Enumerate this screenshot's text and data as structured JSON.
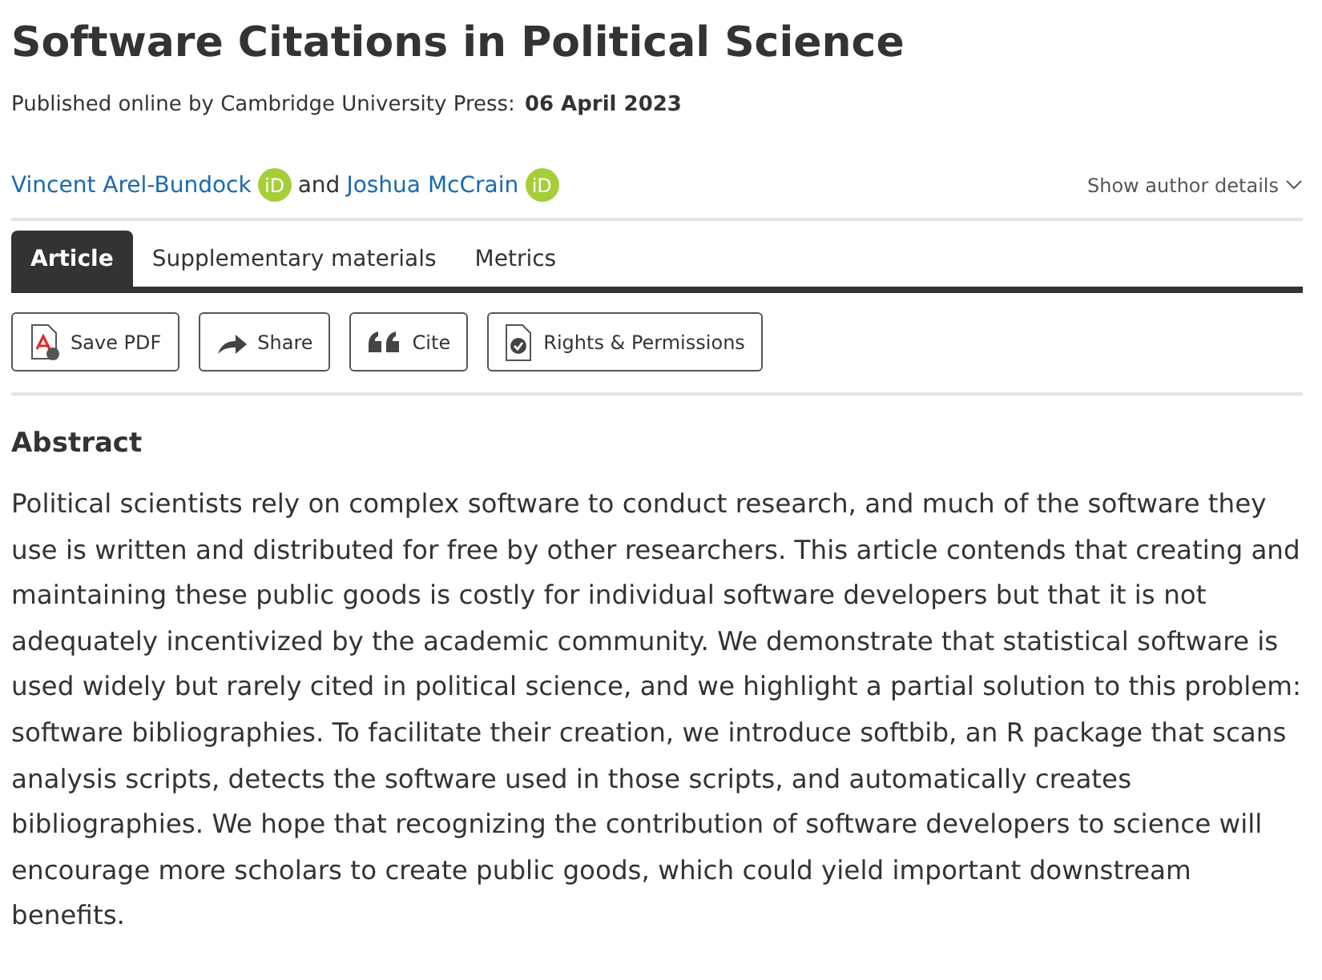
{
  "title": "Software Citations in Political Science",
  "publication": {
    "label": "Published online by Cambridge University Press:",
    "date": "06 April 2023"
  },
  "authors": [
    {
      "name": "Vincent Arel-Bundock",
      "orcid": "iD"
    },
    {
      "name": "Joshua McCrain",
      "orcid": "iD"
    }
  ],
  "author_separator": "and",
  "author_details_toggle": "Show author details",
  "tabs": [
    {
      "label": "Article",
      "selected": true
    },
    {
      "label": "Supplementary materials",
      "selected": false
    },
    {
      "label": "Metrics",
      "selected": false
    }
  ],
  "actions": [
    {
      "kind": "pdf",
      "label": "Save PDF"
    },
    {
      "kind": "share",
      "label": "Share"
    },
    {
      "kind": "cite",
      "label": "Cite"
    },
    {
      "kind": "rights",
      "label": "Rights & Permissions"
    }
  ],
  "abstract": {
    "heading": "Abstract",
    "text": "Political scientists rely on complex software to conduct research, and much of the software they use is written and distributed for free by other researchers. This article contends that creating and maintaining these public goods is costly for individual software developers but that it is not adequately incentivized by the academic community. We demonstrate that statistical software is used widely but rarely cited in political science, and we highlight a partial solution to this problem: software bibliographies. To facilitate their creation, we introduce softbib, an R package that scans analysis scripts, detects the software used in those scripts, and automatically creates bibliographies. We hope that recognizing the contribution of software developers to science will encourage more scholars to create public goods, which could yield important downstream benefits."
  }
}
